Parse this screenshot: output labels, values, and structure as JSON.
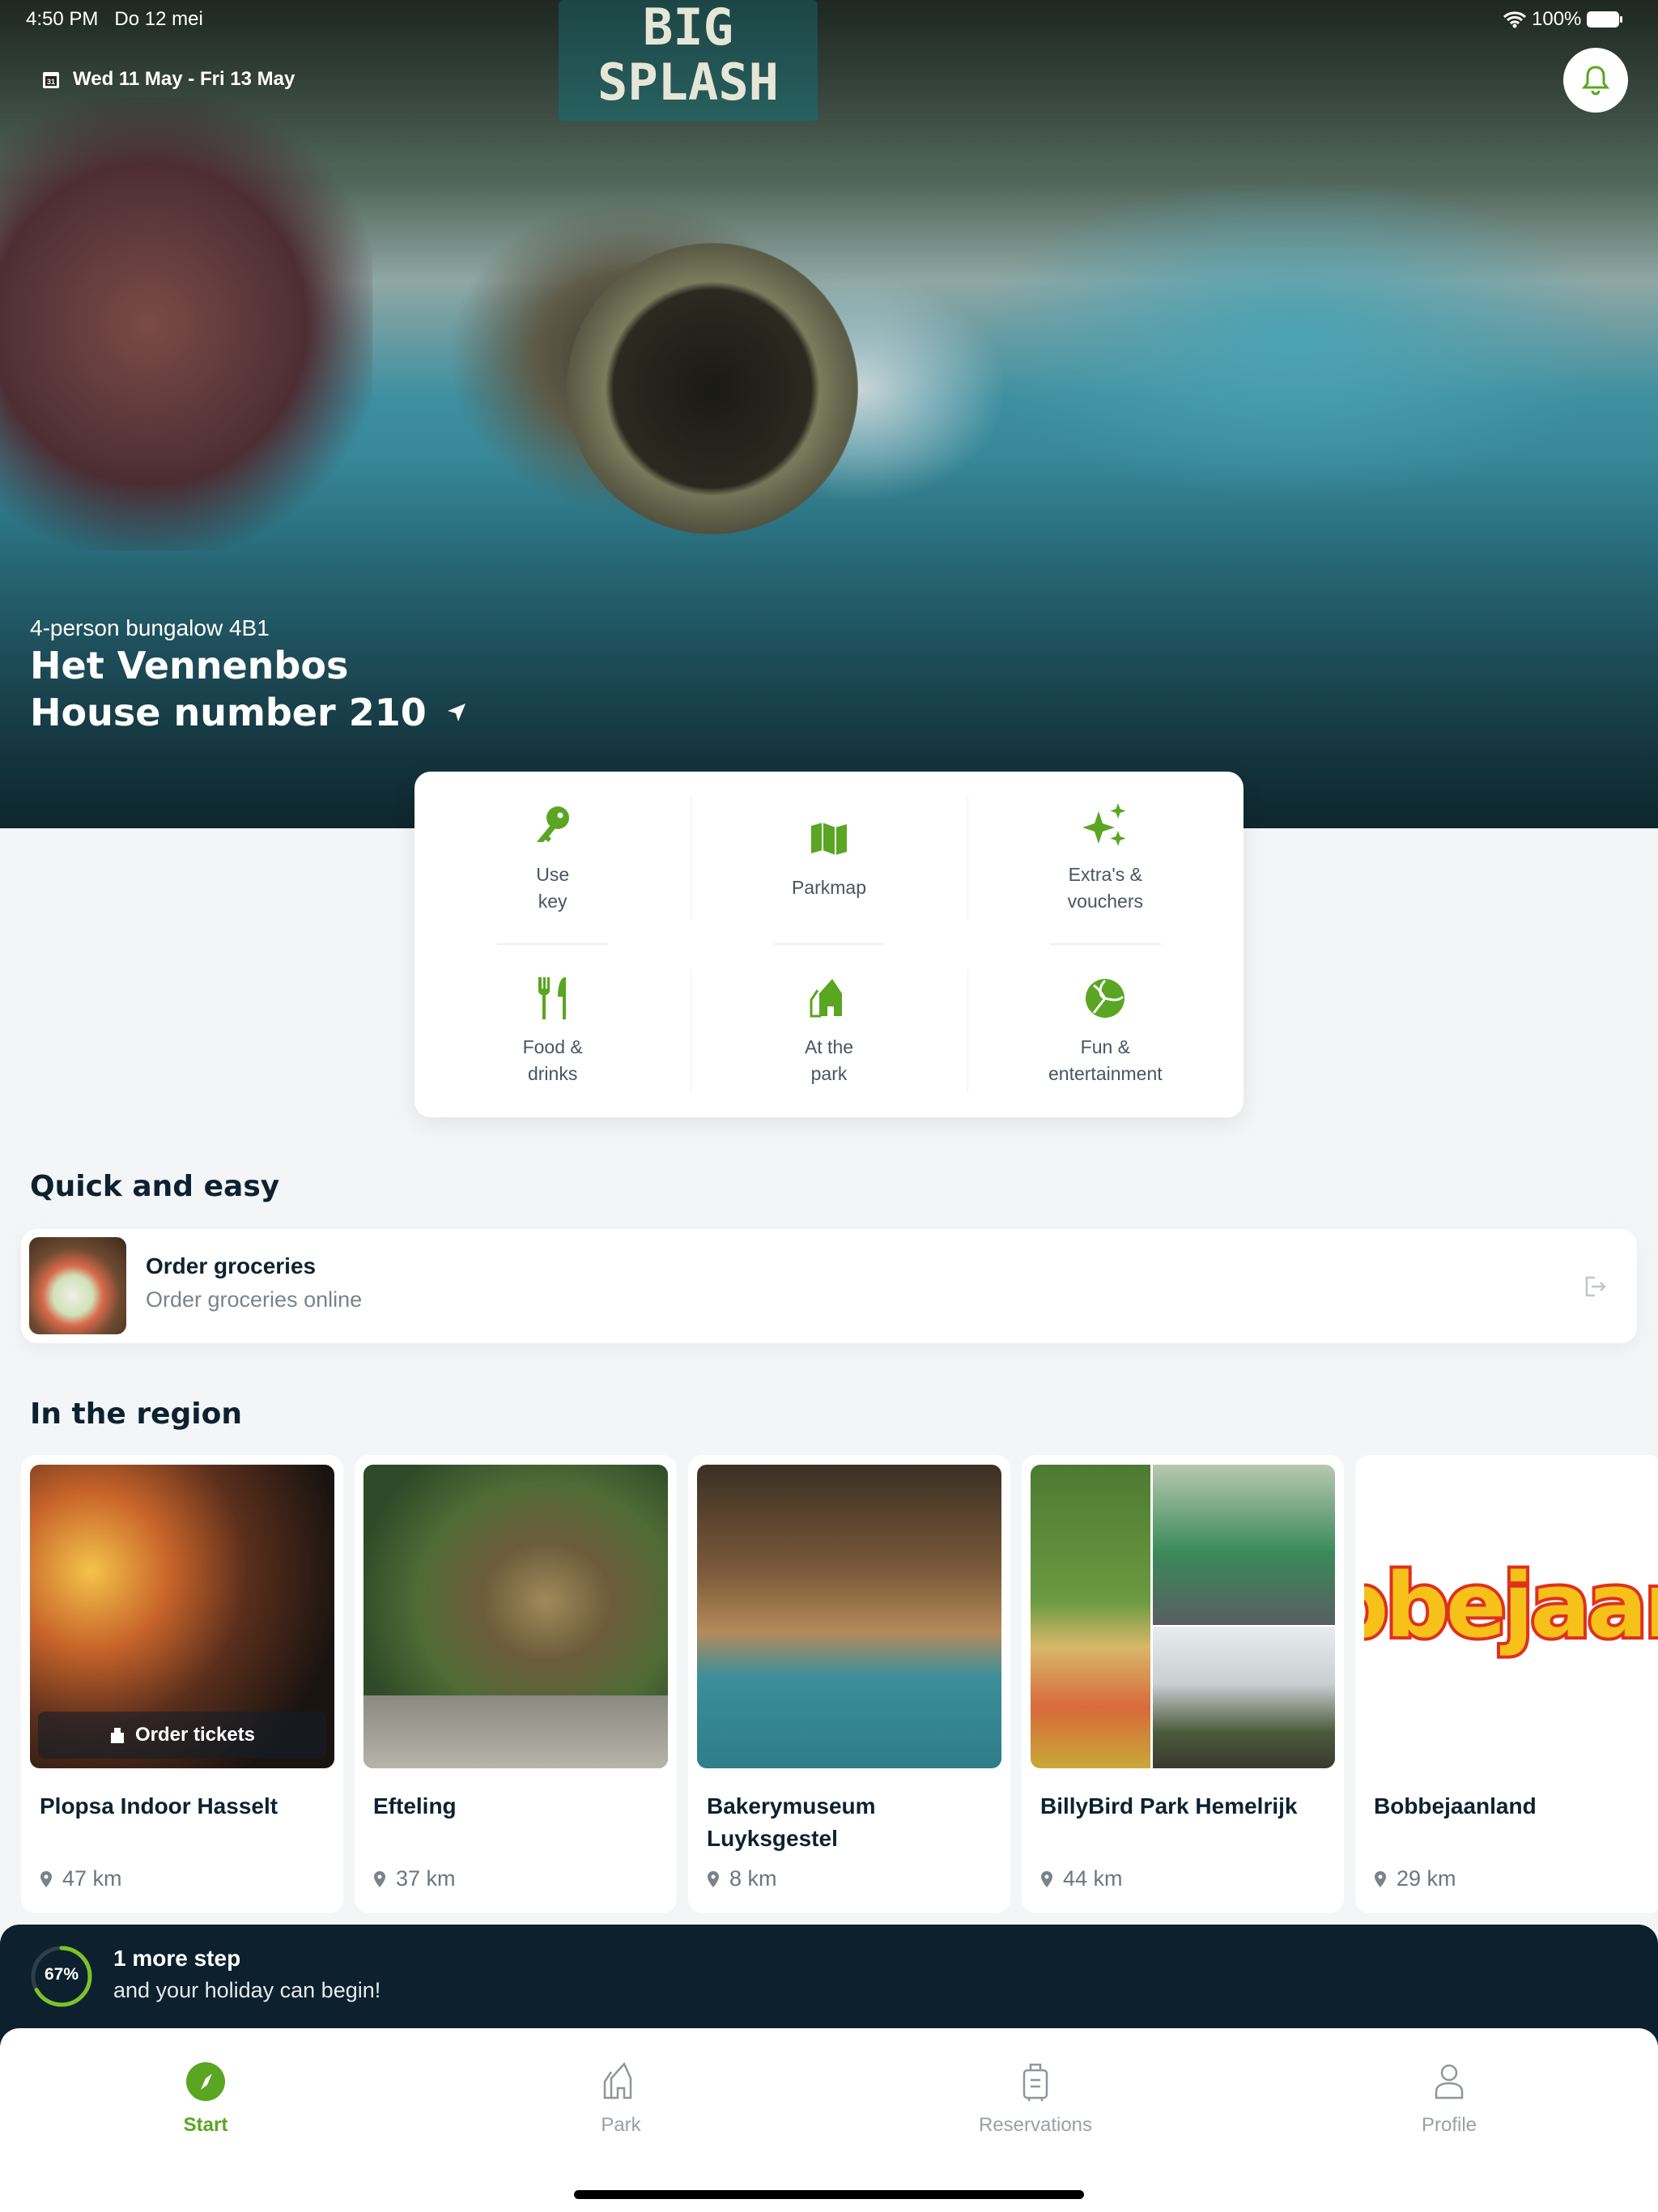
{
  "status_bar": {
    "time": "4:50 PM",
    "date": "Do 12 mei",
    "battery": "100%"
  },
  "hero": {
    "dates": "Wed 11 May - Fri 13 May",
    "accommodation": "4-person bungalow 4B1",
    "park": "Het Vennenbos",
    "house": "House number 210",
    "sign_text": "BIG SPLASH"
  },
  "quick_actions": [
    {
      "label1": "Use",
      "label2": "key",
      "icon": "key-icon"
    },
    {
      "label1": "Parkmap",
      "label2": "",
      "icon": "map-icon"
    },
    {
      "label1": "Extra's &",
      "label2": "vouchers",
      "icon": "sparkles-icon"
    },
    {
      "label1": "Food &",
      "label2": "drinks",
      "icon": "cutlery-icon"
    },
    {
      "label1": "At the",
      "label2": "park",
      "icon": "houses-icon"
    },
    {
      "label1": "Fun &",
      "label2": "entertainment",
      "icon": "ball-icon"
    }
  ],
  "quick_easy": {
    "title": "Quick and easy",
    "item": {
      "title": "Order groceries",
      "subtitle": "Order groceries online"
    }
  },
  "region": {
    "title": "In the region",
    "cards": [
      {
        "name": "Plopsa Indoor Hasselt",
        "distance": "47 km",
        "badge": "Order tickets"
      },
      {
        "name": "Efteling",
        "distance": "37 km"
      },
      {
        "name": "Bakerymuseum Luyksgestel",
        "distance": "8 km"
      },
      {
        "name": "BillyBird Park Hemelrijk",
        "distance": "44 km"
      },
      {
        "name": "Bobbejaanland",
        "distance": "29 km",
        "logo_text": "Bobbejaanland"
      }
    ]
  },
  "progress": {
    "percent_label": "67%",
    "percent": 67,
    "title": "1 more step",
    "subtitle": "and your holiday can begin!"
  },
  "tabs": [
    {
      "label": "Start",
      "active": true
    },
    {
      "label": "Park"
    },
    {
      "label": "Reservations"
    },
    {
      "label": "Profile"
    }
  ],
  "colors": {
    "accent": "#5aa522",
    "dark": "#0c202d",
    "background": "#f3f5f7"
  }
}
